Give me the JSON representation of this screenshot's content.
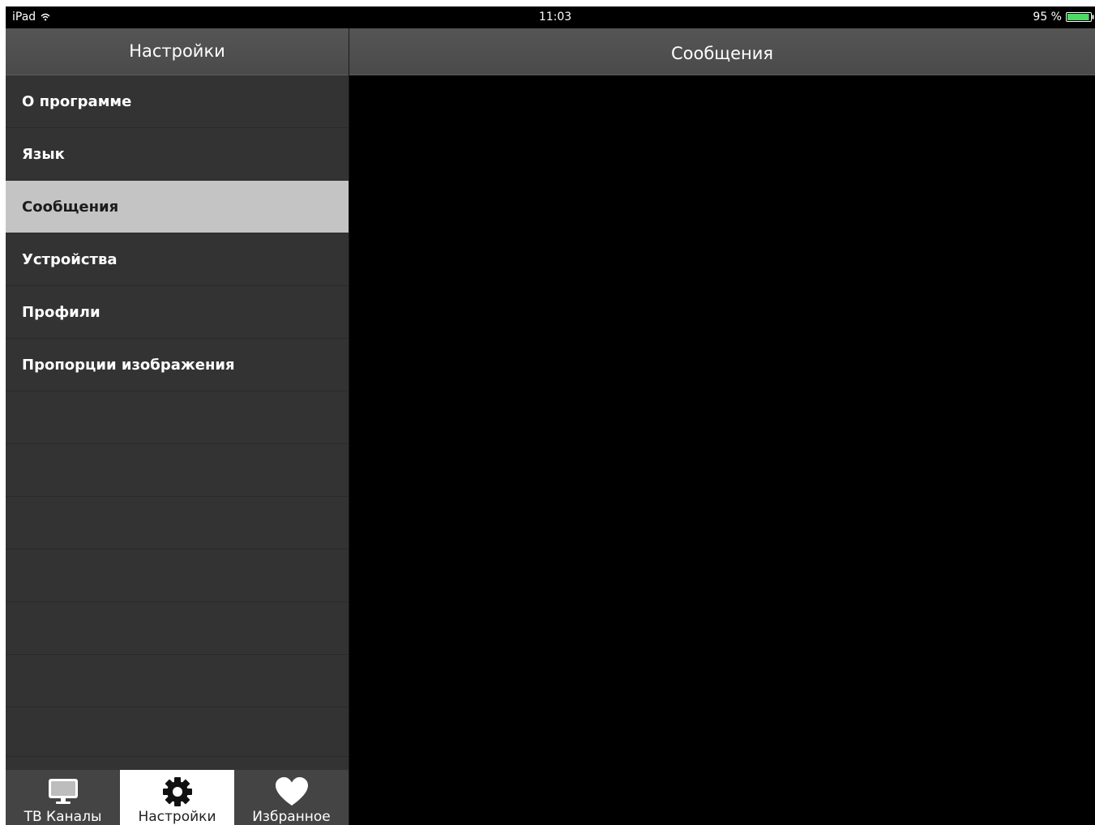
{
  "status_bar": {
    "device": "iPad",
    "time": "11:03",
    "battery": "95 %",
    "battery_color": "#4cd964"
  },
  "left_pane": {
    "title": "Настройки",
    "items": [
      {
        "label": "О программе",
        "selected": false
      },
      {
        "label": "Язык",
        "selected": false
      },
      {
        "label": "Сообщения",
        "selected": true
      },
      {
        "label": "Устройства",
        "selected": false
      },
      {
        "label": "Профили",
        "selected": false
      },
      {
        "label": "Пропорции изображения",
        "selected": false
      }
    ],
    "selected_bg": "#c4c4c4"
  },
  "tab_bar": {
    "tabs": [
      {
        "label": "ТВ Каналы",
        "icon": "monitor-icon",
        "active": false
      },
      {
        "label": "Настройки",
        "icon": "gear-icon",
        "active": true
      },
      {
        "label": "Избранное",
        "icon": "heart-icon",
        "active": false
      }
    ]
  },
  "right_pane": {
    "title": "Сообщения"
  }
}
